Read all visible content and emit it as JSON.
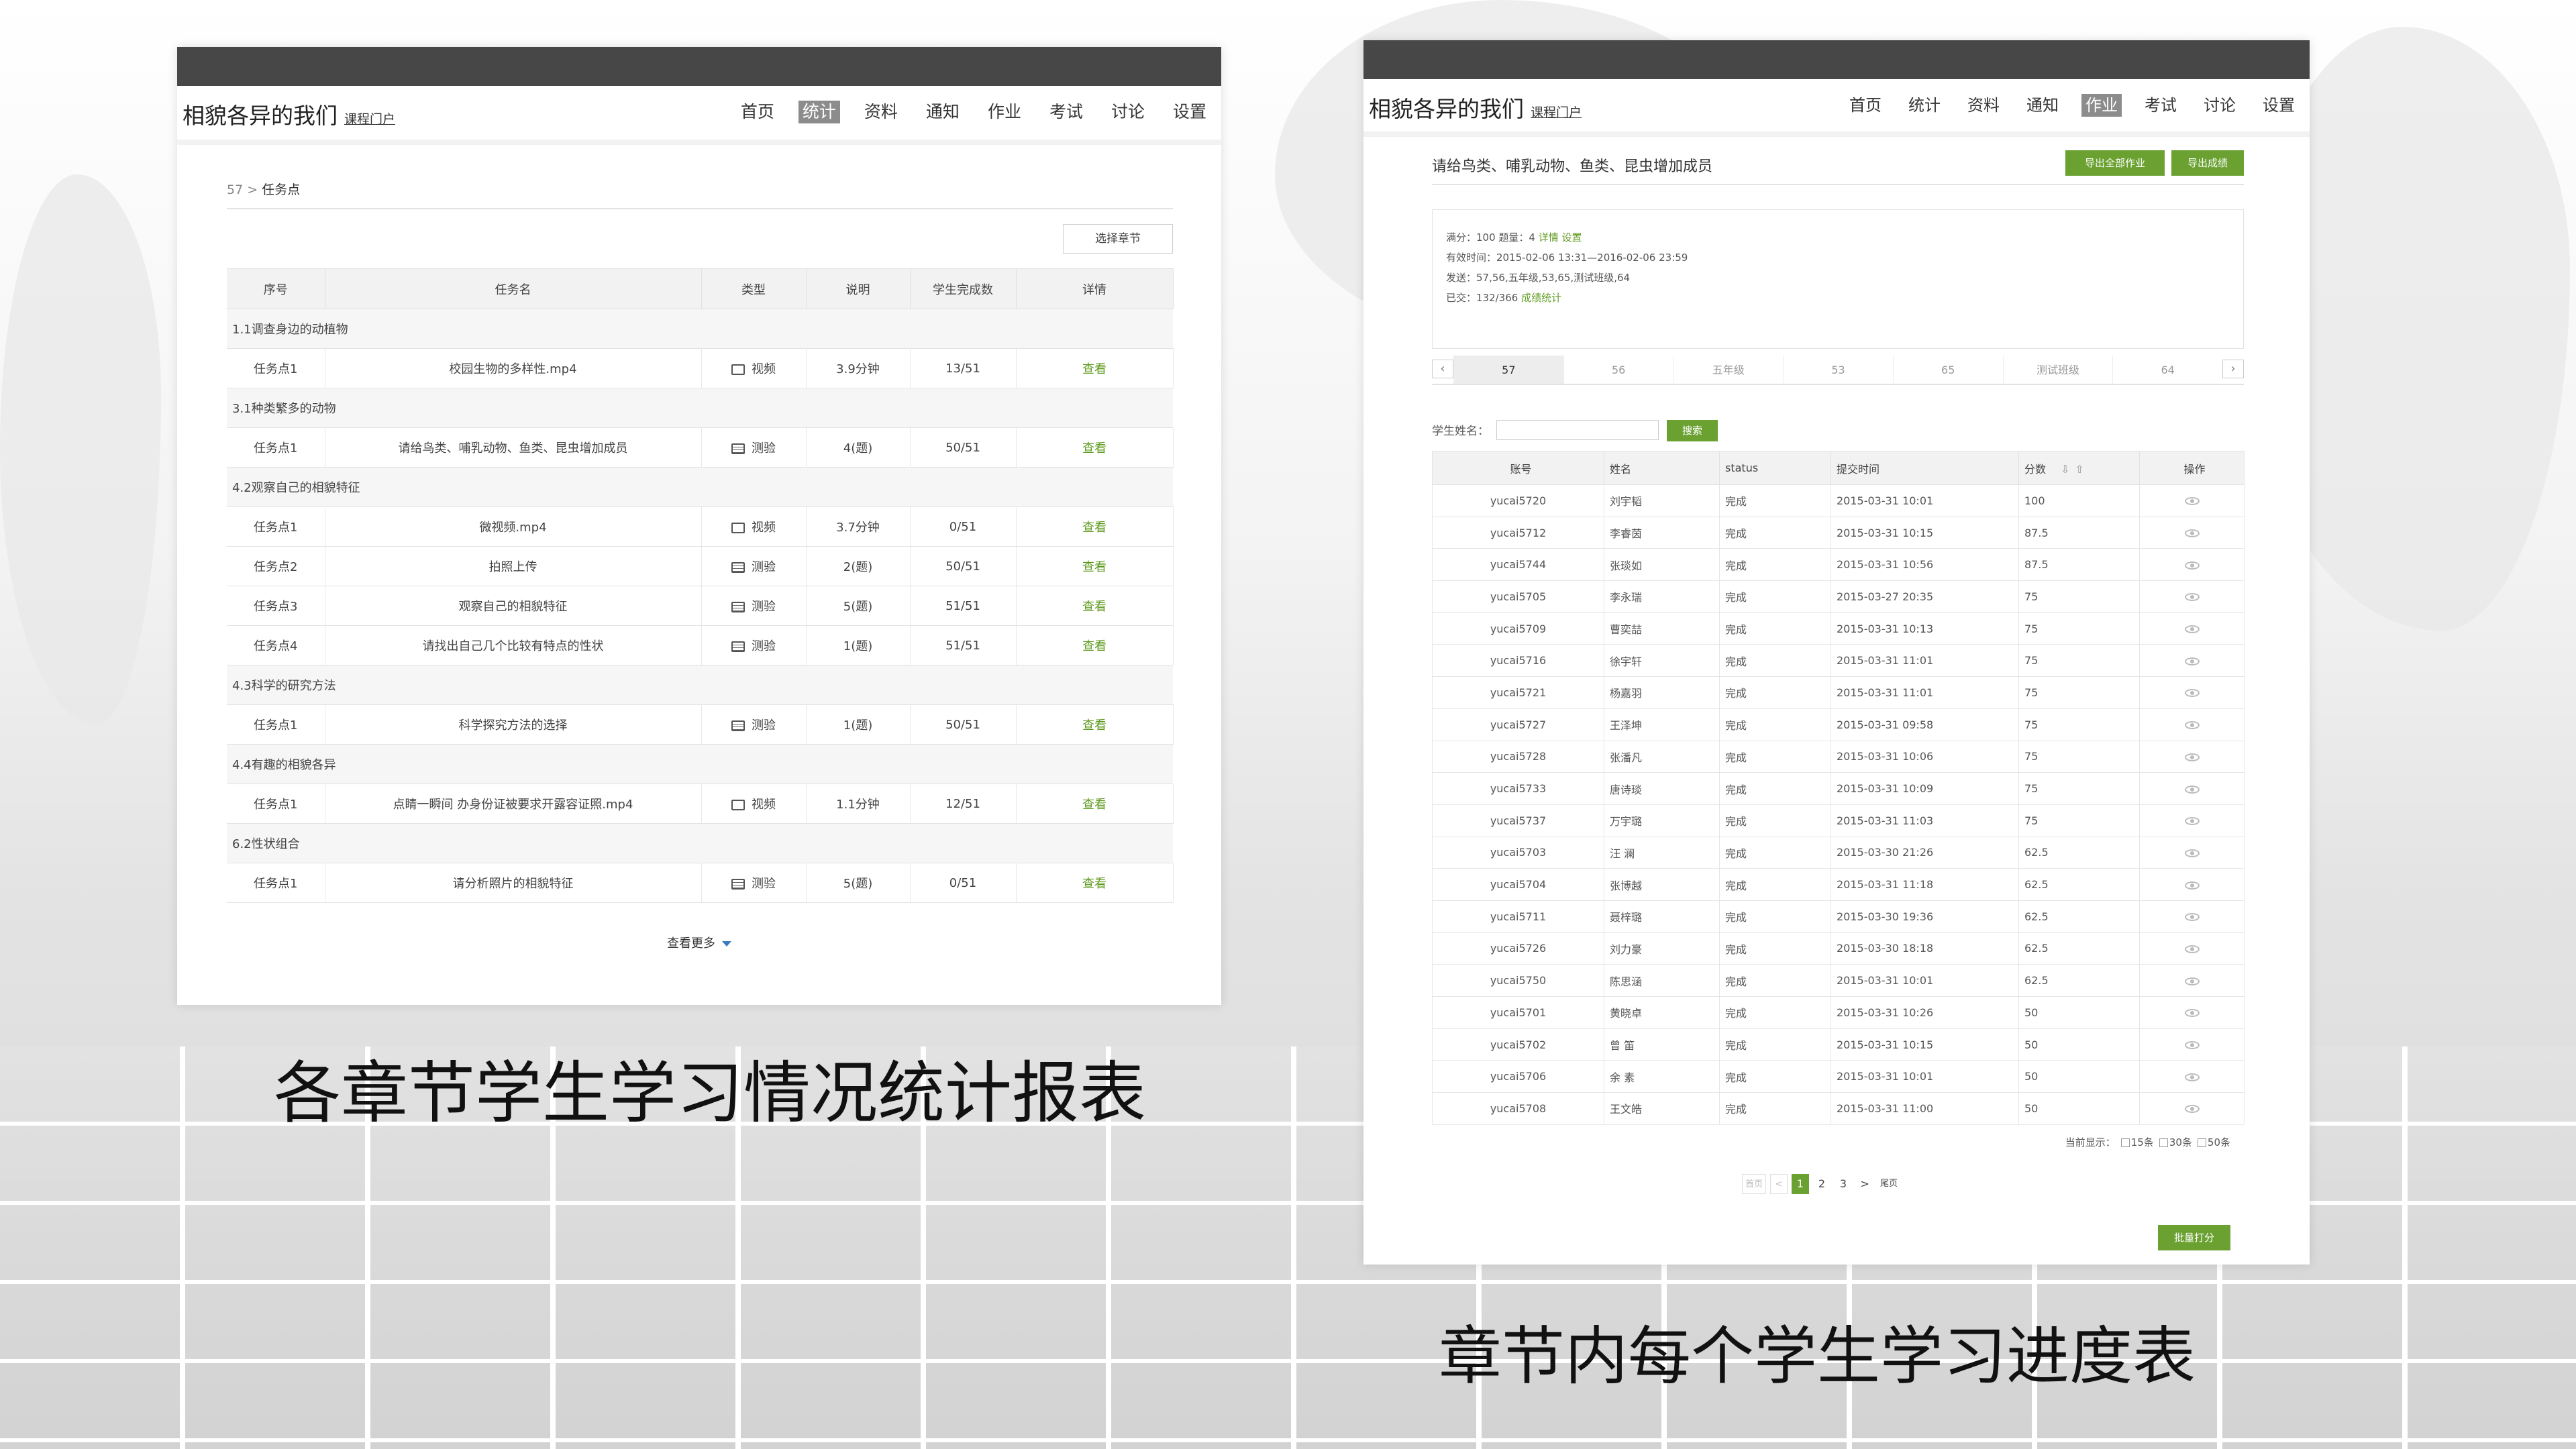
{
  "captions": {
    "left": "各章节学生学习情况统计报表",
    "right": "章节内每个学生学习进度表"
  },
  "screen1": {
    "site_name": "相貌各异的我们",
    "portal_link": "课程门户",
    "nav": [
      "首页",
      "统计",
      "资料",
      "通知",
      "作业",
      "考试",
      "讨论",
      "设置"
    ],
    "nav_active": "统计",
    "breadcrumb_prefix": "57 >",
    "breadcrumb_current": "任务点",
    "select_chapter_button": "选择章节",
    "columns": [
      "序号",
      "任务名",
      "类型",
      "说明",
      "学生完成数",
      "详情"
    ],
    "sections": [
      {
        "title": "1.1调查身边的动植物",
        "rows": [
          {
            "no": "任务点1",
            "name": "校园生物的多样性.mp4",
            "type": "视频",
            "type_icon": "monitor-icon",
            "desc": "3.9分钟",
            "done": "13/51",
            "action": "查看"
          }
        ]
      },
      {
        "title": "3.1种类繁多的动物",
        "rows": [
          {
            "no": "任务点1",
            "name": "请给鸟类、哺乳动物、鱼类、昆虫增加成员",
            "type": "测验",
            "type_icon": "quiz-icon",
            "desc": "4(题)",
            "done": "50/51",
            "action": "查看"
          }
        ]
      },
      {
        "title": "4.2观察自己的相貌特征",
        "rows": [
          {
            "no": "任务点1",
            "name": "微视频.mp4",
            "type": "视频",
            "type_icon": "monitor-icon",
            "desc": "3.7分钟",
            "done": "0/51",
            "action": "查看"
          },
          {
            "no": "任务点2",
            "name": "拍照上传",
            "type": "测验",
            "type_icon": "quiz-icon",
            "desc": "2(题)",
            "done": "50/51",
            "action": "查看"
          },
          {
            "no": "任务点3",
            "name": "观察自己的相貌特征",
            "type": "测验",
            "type_icon": "quiz-icon",
            "desc": "5(题)",
            "done": "51/51",
            "action": "查看"
          },
          {
            "no": "任务点4",
            "name": "请找出自己几个比较有特点的性状",
            "type": "测验",
            "type_icon": "quiz-icon",
            "desc": "1(题)",
            "done": "51/51",
            "action": "查看"
          }
        ]
      },
      {
        "title": "4.3科学的研究方法",
        "rows": [
          {
            "no": "任务点1",
            "name": "科学探究方法的选择",
            "type": "测验",
            "type_icon": "quiz-icon",
            "desc": "1(题)",
            "done": "50/51",
            "action": "查看"
          }
        ]
      },
      {
        "title": "4.4有趣的相貌各异",
        "rows": [
          {
            "no": "任务点1",
            "name": "点睛一瞬间 办身份证被要求开露容证照.mp4",
            "type": "视频",
            "type_icon": "monitor-icon",
            "desc": "1.1分钟",
            "done": "12/51",
            "action": "查看"
          }
        ]
      },
      {
        "title": "6.2性状组合",
        "rows": [
          {
            "no": "任务点1",
            "name": "请分析照片的相貌特征",
            "type": "测验",
            "type_icon": "quiz-icon",
            "desc": "5(题)",
            "done": "0/51",
            "action": "查看"
          }
        ]
      }
    ],
    "more_label": "查看更多"
  },
  "screen2": {
    "site_name": "相貌各异的我们",
    "portal_link": "课程门户",
    "nav": [
      "首页",
      "统计",
      "资料",
      "通知",
      "作业",
      "考试",
      "讨论",
      "设置"
    ],
    "nav_active": "作业",
    "page_title": "请给鸟类、哺乳动物、鱼类、昆虫增加成员",
    "export_all_button": "导出全部作业",
    "export_scores_button": "导出成绩",
    "info": {
      "line1_text": "满分：100   题量：4",
      "line1_link1": "详情",
      "line1_link2": "设置",
      "line2": "有效时间：2015-02-06 13:31—2016-02-06 23:59",
      "line3": "发送：57,56,五年级,53,65,测试班级,64",
      "line4_text": "已交：132/366",
      "line4_link": "成绩统计"
    },
    "class_tabs": [
      "57",
      "56",
      "五年级",
      "53",
      "65",
      "测试班级",
      "64"
    ],
    "class_tab_active": "57",
    "search_label": "学生姓名：",
    "search_value": "",
    "search_button": "搜索",
    "columns": [
      "账号",
      "姓名",
      "status",
      "提交时间",
      "分数",
      "操作"
    ],
    "rows": [
      {
        "account": "yucai5720",
        "name": "刘宇韬",
        "status": "完成",
        "time": "2015-03-31 10:01",
        "score": "100"
      },
      {
        "account": "yucai5712",
        "name": "李睿茵",
        "status": "完成",
        "time": "2015-03-31 10:15",
        "score": "87.5"
      },
      {
        "account": "yucai5744",
        "name": "张琰如",
        "status": "完成",
        "time": "2015-03-31 10:56",
        "score": "87.5"
      },
      {
        "account": "yucai5705",
        "name": "李永瑞",
        "status": "完成",
        "time": "2015-03-27 20:35",
        "score": "75"
      },
      {
        "account": "yucai5709",
        "name": "曹奕喆",
        "status": "完成",
        "time": "2015-03-31 10:13",
        "score": "75"
      },
      {
        "account": "yucai5716",
        "name": "徐宇轩",
        "status": "完成",
        "time": "2015-03-31 11:01",
        "score": "75"
      },
      {
        "account": "yucai5721",
        "name": "杨嘉羽",
        "status": "完成",
        "time": "2015-03-31 11:01",
        "score": "75"
      },
      {
        "account": "yucai5727",
        "name": "王泽坤",
        "status": "完成",
        "time": "2015-03-31 09:58",
        "score": "75"
      },
      {
        "account": "yucai5728",
        "name": "张潘凡",
        "status": "完成",
        "time": "2015-03-31 10:06",
        "score": "75"
      },
      {
        "account": "yucai5733",
        "name": "唐诗琰",
        "status": "完成",
        "time": "2015-03-31 10:09",
        "score": "75"
      },
      {
        "account": "yucai5737",
        "name": "万宇璐",
        "status": "完成",
        "time": "2015-03-31 11:03",
        "score": "75"
      },
      {
        "account": "yucai5703",
        "name": "汪 澜",
        "status": "完成",
        "time": "2015-03-30 21:26",
        "score": "62.5"
      },
      {
        "account": "yucai5704",
        "name": "张博越",
        "status": "完成",
        "time": "2015-03-31 11:18",
        "score": "62.5"
      },
      {
        "account": "yucai5711",
        "name": "聂梓璐",
        "status": "完成",
        "time": "2015-03-30 19:36",
        "score": "62.5"
      },
      {
        "account": "yucai5726",
        "name": "刘力豪",
        "status": "完成",
        "time": "2015-03-30 18:18",
        "score": "62.5"
      },
      {
        "account": "yucai5750",
        "name": "陈思涵",
        "status": "完成",
        "time": "2015-03-31 10:01",
        "score": "62.5"
      },
      {
        "account": "yucai5701",
        "name": "黄晓卓",
        "status": "完成",
        "time": "2015-03-31 10:26",
        "score": "50"
      },
      {
        "account": "yucai5702",
        "name": "曾 笛",
        "status": "完成",
        "time": "2015-03-31 10:15",
        "score": "50"
      },
      {
        "account": "yucai5706",
        "name": "余 素",
        "status": "完成",
        "time": "2015-03-31 10:01",
        "score": "50"
      },
      {
        "account": "yucai5708",
        "name": "王文皓",
        "status": "完成",
        "time": "2015-03-31 11:00",
        "score": "50"
      }
    ],
    "per_page_label": "当前显示：",
    "per_page_options": [
      "15条",
      "30条",
      "50条"
    ],
    "pager": {
      "first": "首页",
      "prev": "<",
      "pages": [
        "1",
        "2",
        "3"
      ],
      "current": "1",
      "next": ">",
      "last": "尾页"
    },
    "batch_score_button": "批量打分"
  }
}
